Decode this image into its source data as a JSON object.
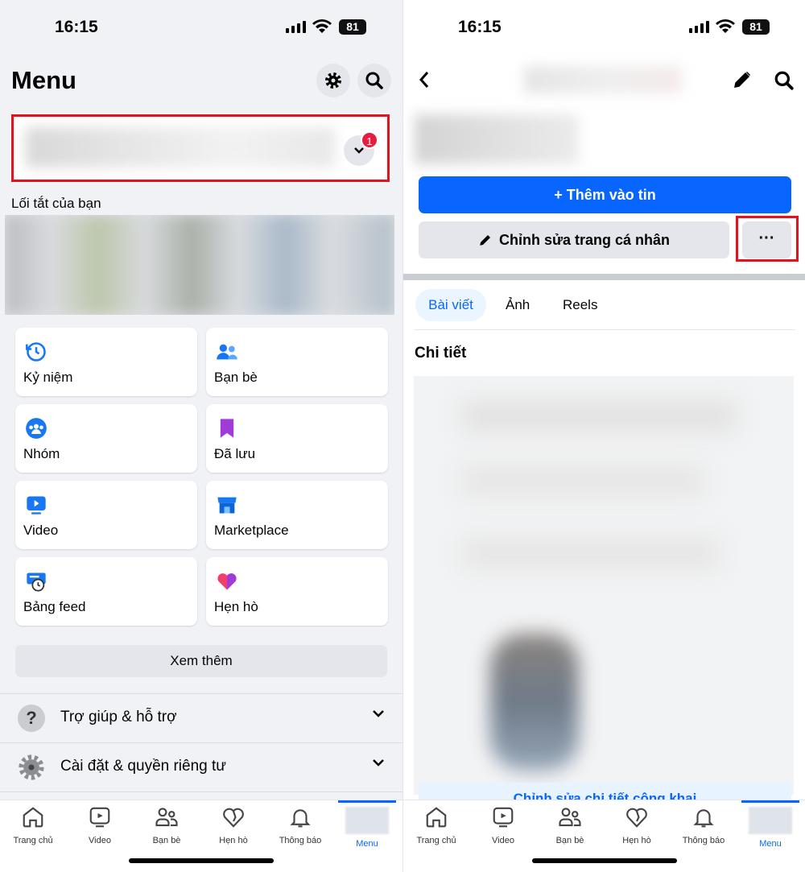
{
  "status": {
    "time": "16:15",
    "battery": "81"
  },
  "left": {
    "title": "Menu",
    "badge": "1",
    "shortcuts_label": "Lối tắt của bạn",
    "grid": [
      {
        "label": "Kỷ niệm",
        "icon": "memories-clock-icon"
      },
      {
        "label": "Bạn bè",
        "icon": "friends-icon"
      },
      {
        "label": "Nhóm",
        "icon": "groups-icon"
      },
      {
        "label": "Đã lưu",
        "icon": "saved-bookmark-icon"
      },
      {
        "label": "Video",
        "icon": "video-icon"
      },
      {
        "label": "Marketplace",
        "icon": "marketplace-icon"
      },
      {
        "label": "Bảng feed",
        "icon": "feeds-icon"
      },
      {
        "label": "Hẹn hò",
        "icon": "dating-heart-icon"
      }
    ],
    "see_more": "Xem thêm",
    "rows": [
      {
        "label": "Trợ giúp & hỗ trợ"
      },
      {
        "label": "Cài đặt & quyền riêng tư"
      }
    ]
  },
  "right": {
    "add_story": "+ Thêm vào tin",
    "edit_profile": "Chỉnh sửa trang cá nhân",
    "more": "···",
    "tabs": [
      {
        "label": "Bài viết",
        "active": true
      },
      {
        "label": "Ảnh"
      },
      {
        "label": "Reels"
      }
    ],
    "details_title": "Chi tiết",
    "edit_public": "Chỉnh sửa chi tiết công khai"
  },
  "tabbar": [
    {
      "label": "Trang chủ"
    },
    {
      "label": "Video"
    },
    {
      "label": "Bạn bè"
    },
    {
      "label": "Hẹn hò"
    },
    {
      "label": "Thông báo"
    },
    {
      "label": "Menu",
      "active": true
    }
  ],
  "colors": {
    "accent": "#0866ff",
    "highlight": "#e0141e",
    "badge": "#e41e3f"
  }
}
